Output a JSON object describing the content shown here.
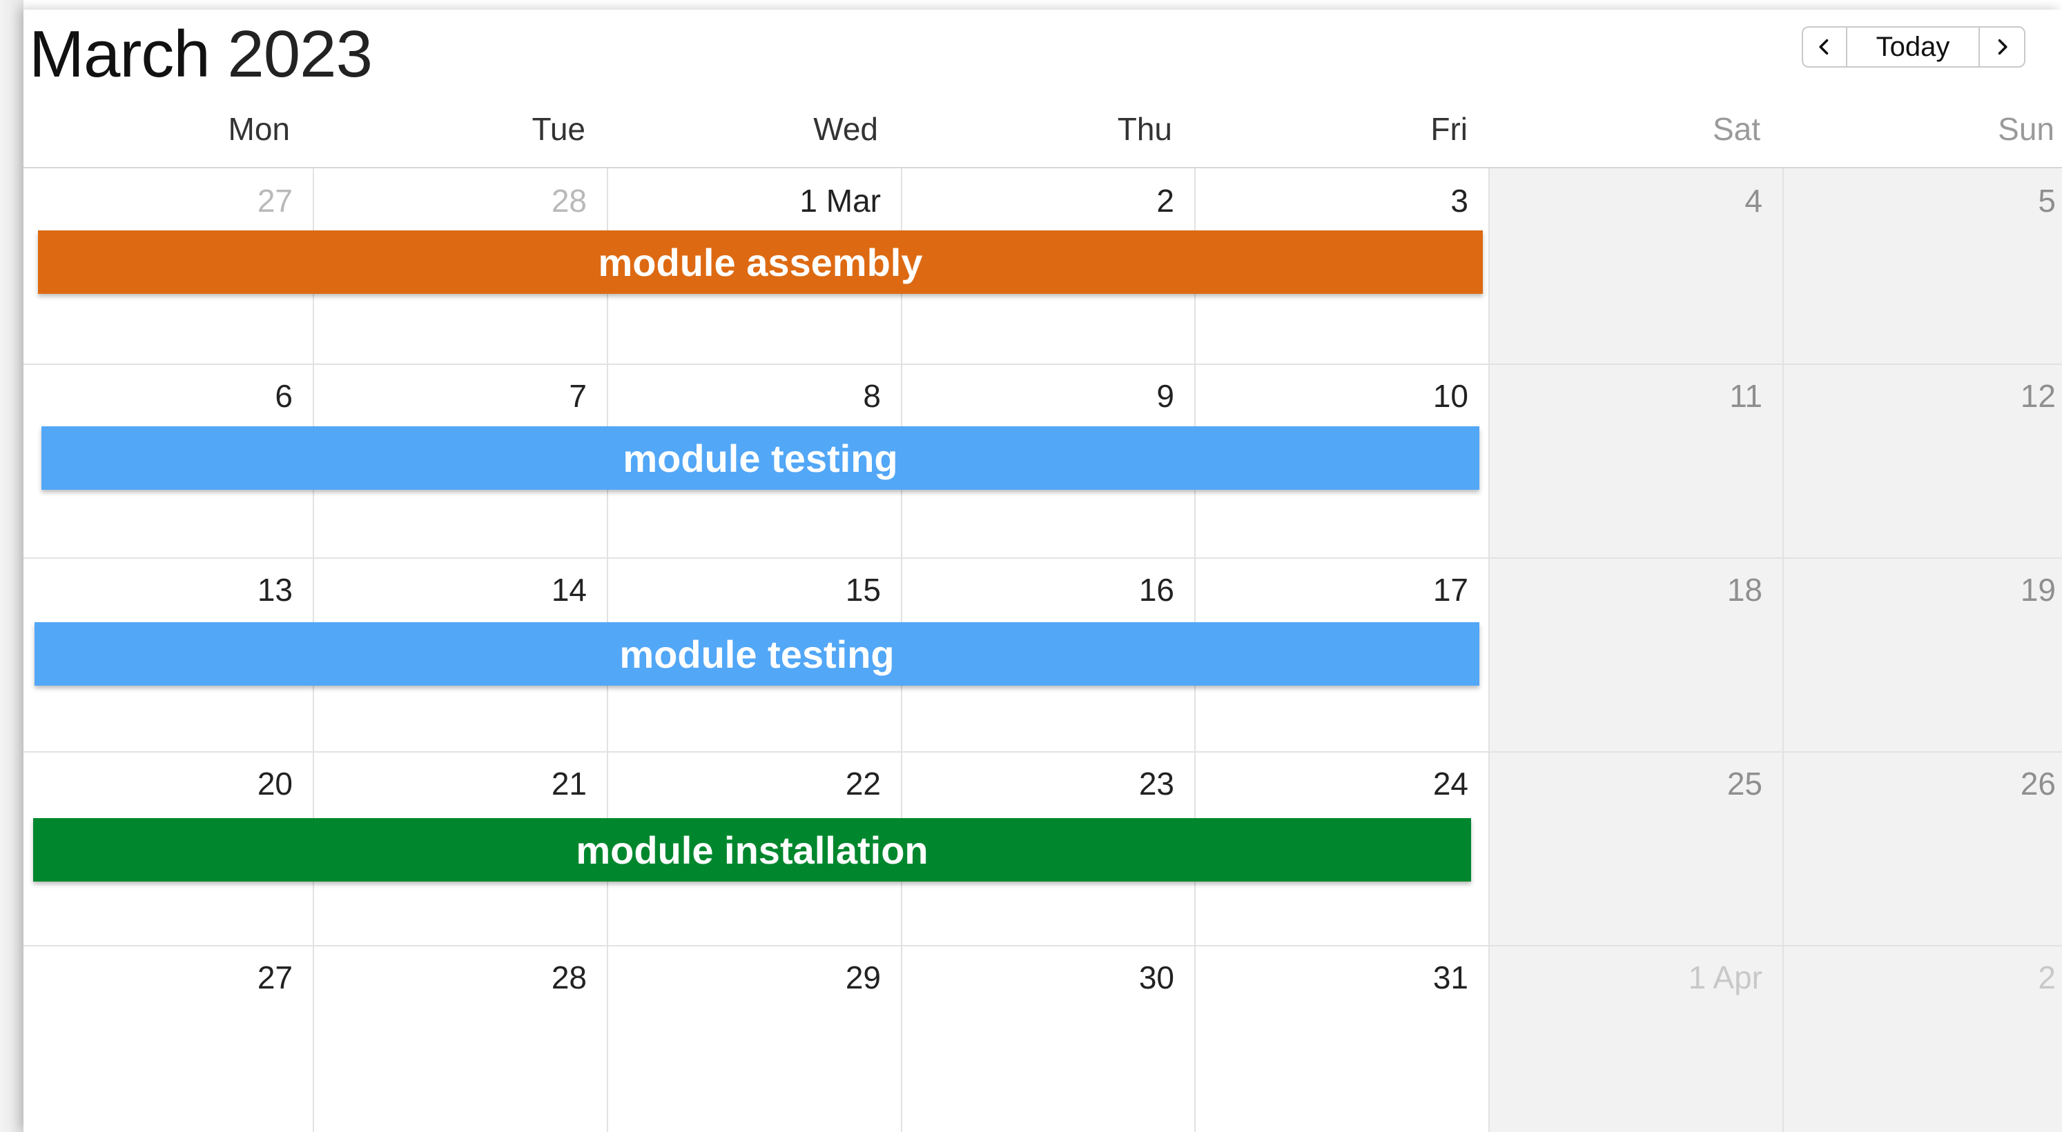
{
  "header": {
    "month": "March",
    "year": "2023",
    "today_label": "Today",
    "prev_icon": "chevron-left-icon",
    "next_icon": "chevron-right-icon"
  },
  "weekdays": [
    "Mon",
    "Tue",
    "Wed",
    "Thu",
    "Fri",
    "Sat",
    "Sun"
  ],
  "weeks": [
    {
      "days": [
        "27",
        "28",
        "1 Mar",
        "2",
        "3",
        "4",
        "5"
      ],
      "other_month": [
        true,
        true,
        false,
        false,
        false,
        false,
        false
      ]
    },
    {
      "days": [
        "6",
        "7",
        "8",
        "9",
        "10",
        "11",
        "12"
      ],
      "other_month": [
        false,
        false,
        false,
        false,
        false,
        false,
        false
      ]
    },
    {
      "days": [
        "13",
        "14",
        "15",
        "16",
        "17",
        "18",
        "19"
      ],
      "other_month": [
        false,
        false,
        false,
        false,
        false,
        false,
        false
      ]
    },
    {
      "days": [
        "20",
        "21",
        "22",
        "23",
        "24",
        "25",
        "26"
      ],
      "other_month": [
        false,
        false,
        false,
        false,
        false,
        false,
        false
      ]
    },
    {
      "days": [
        "27",
        "28",
        "29",
        "30",
        "31",
        "1 Apr",
        "2"
      ],
      "other_month": [
        false,
        false,
        false,
        false,
        false,
        true,
        true
      ]
    }
  ],
  "events": [
    {
      "title": "module assembly",
      "week": 0,
      "color": "#dd6a12"
    },
    {
      "title": "module testing",
      "week": 1,
      "color": "#52a7f7"
    },
    {
      "title": "module testing",
      "week": 2,
      "color": "#52a7f7"
    },
    {
      "title": "module installation",
      "week": 3,
      "color": "#00872e"
    }
  ]
}
